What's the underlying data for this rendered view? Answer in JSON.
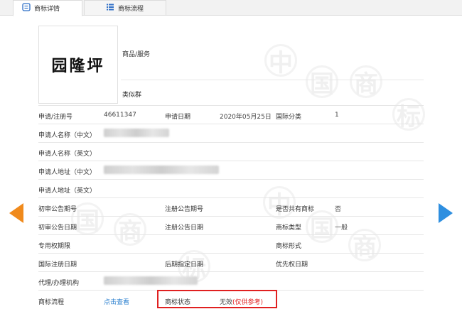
{
  "tabs": [
    {
      "label": "商标详情",
      "icon": "document-icon",
      "active": true
    },
    {
      "label": "商标流程",
      "icon": "list-icon",
      "active": false
    }
  ],
  "trademark": {
    "logo_text": "园隆坪",
    "goods_services_label": "商品/服务",
    "similar_group_label": "类似群"
  },
  "fields": {
    "reg_no_label": "申请/注册号",
    "reg_no_value": "46611347",
    "apply_date_label": "申请日期",
    "apply_date_value": "2020年05月25日",
    "intl_class_label": "国际分类",
    "intl_class_value": "1",
    "applicant_cn_label": "申请人名称（中文）",
    "applicant_en_label": "申请人名称（英文）",
    "address_cn_label": "申请人地址（中文）",
    "address_en_label": "申请人地址（英文）",
    "prelim_no_label": "初审公告期号",
    "reg_notice_no_label": "注册公告期号",
    "shared_label": "是否共有商标",
    "shared_value": "否",
    "prelim_date_label": "初审公告日期",
    "reg_notice_date_label": "注册公告日期",
    "tm_type_label": "商标类型",
    "tm_type_value": "一般",
    "exclusive_period_label": "专用权期限",
    "tm_form_label": "商标形式",
    "intl_reg_date_label": "国际注册日期",
    "later_date_label": "后期指定日期",
    "priority_date_label": "优先权日期",
    "agent_label": "代理/办理机构",
    "process_label": "商标流程",
    "process_link": "点击查看",
    "status_label": "商标状态",
    "status_value": "无效",
    "status_note": "(仅供参考)"
  },
  "watermark_chars": [
    "中",
    "国",
    "商",
    "标"
  ],
  "colors": {
    "link": "#2a7fcf",
    "status_red": "#e02020",
    "prev_arrow": "#f08a1c",
    "next_arrow": "#2e8fe0"
  }
}
